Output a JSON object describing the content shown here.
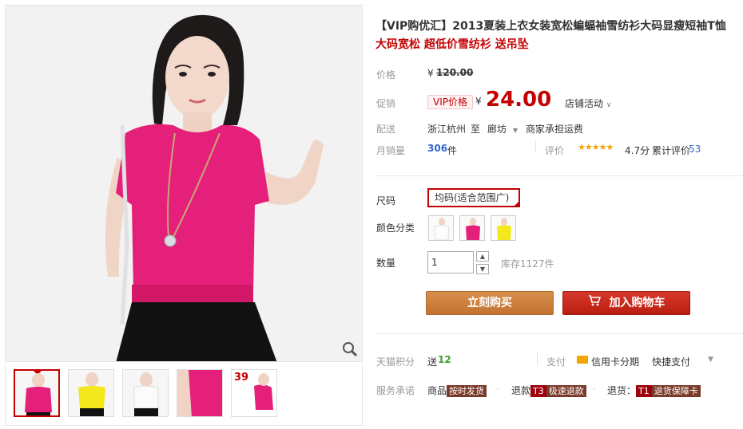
{
  "product": {
    "title": "【VIP购优汇】2013夏装上衣女装宽松蝙蝠袖雪纺衫大码显瘦短袖T恤",
    "subtitle": "大码宽松 超低价雪纺衫 送吊坠"
  },
  "price": {
    "label": "价格",
    "currency": "¥",
    "original": "120.00"
  },
  "promo": {
    "label": "促销",
    "tag": "VIP价格",
    "currency": "¥",
    "value": "24.00",
    "shop_activity": "店铺活动"
  },
  "shipping": {
    "label": "配送",
    "from": "浙江杭州",
    "to_word": "至",
    "to": "廊坊",
    "fee_note": "商家承担运费"
  },
  "sales": {
    "monthly_label": "月销量",
    "monthly_value": "306",
    "monthly_unit": "件",
    "rating_label": "评价",
    "stars": 4.7,
    "score": "4.7分",
    "review_label": "累计评价",
    "review_count": "53"
  },
  "options": {
    "size_label": "尺码",
    "size_value": "均码(适合范围广)",
    "color_label": "颜色分类",
    "colors": [
      "white",
      "rose",
      "yellow"
    ]
  },
  "quantity": {
    "label": "数量",
    "value": "1",
    "stock": "库存1127件"
  },
  "actions": {
    "buy": "立刻购买",
    "add_cart": "加入购物车"
  },
  "points": {
    "label": "天猫积分",
    "send_word": "送",
    "value": "12"
  },
  "payment": {
    "label": "支付",
    "credit": "信用卡分期",
    "quick": "快捷支付"
  },
  "service": {
    "label": "服务承诺",
    "items": [
      {
        "prefix": "商品",
        "tag": "按时发货"
      },
      {
        "prefix": "退款",
        "code": "T3",
        "tag": "极速退款"
      },
      {
        "prefix": "退货",
        "code": "T1",
        "tag": "退货保障卡"
      }
    ]
  },
  "thumbnails": {
    "badge_number": "39"
  },
  "colors": {
    "accent": "#c40000",
    "buy_button": "#c9803c",
    "cart_button": "#c4261a",
    "shirt_rose": "#e4207a",
    "shirt_yellow": "#f3e81c",
    "link_blue": "#3366cc"
  }
}
